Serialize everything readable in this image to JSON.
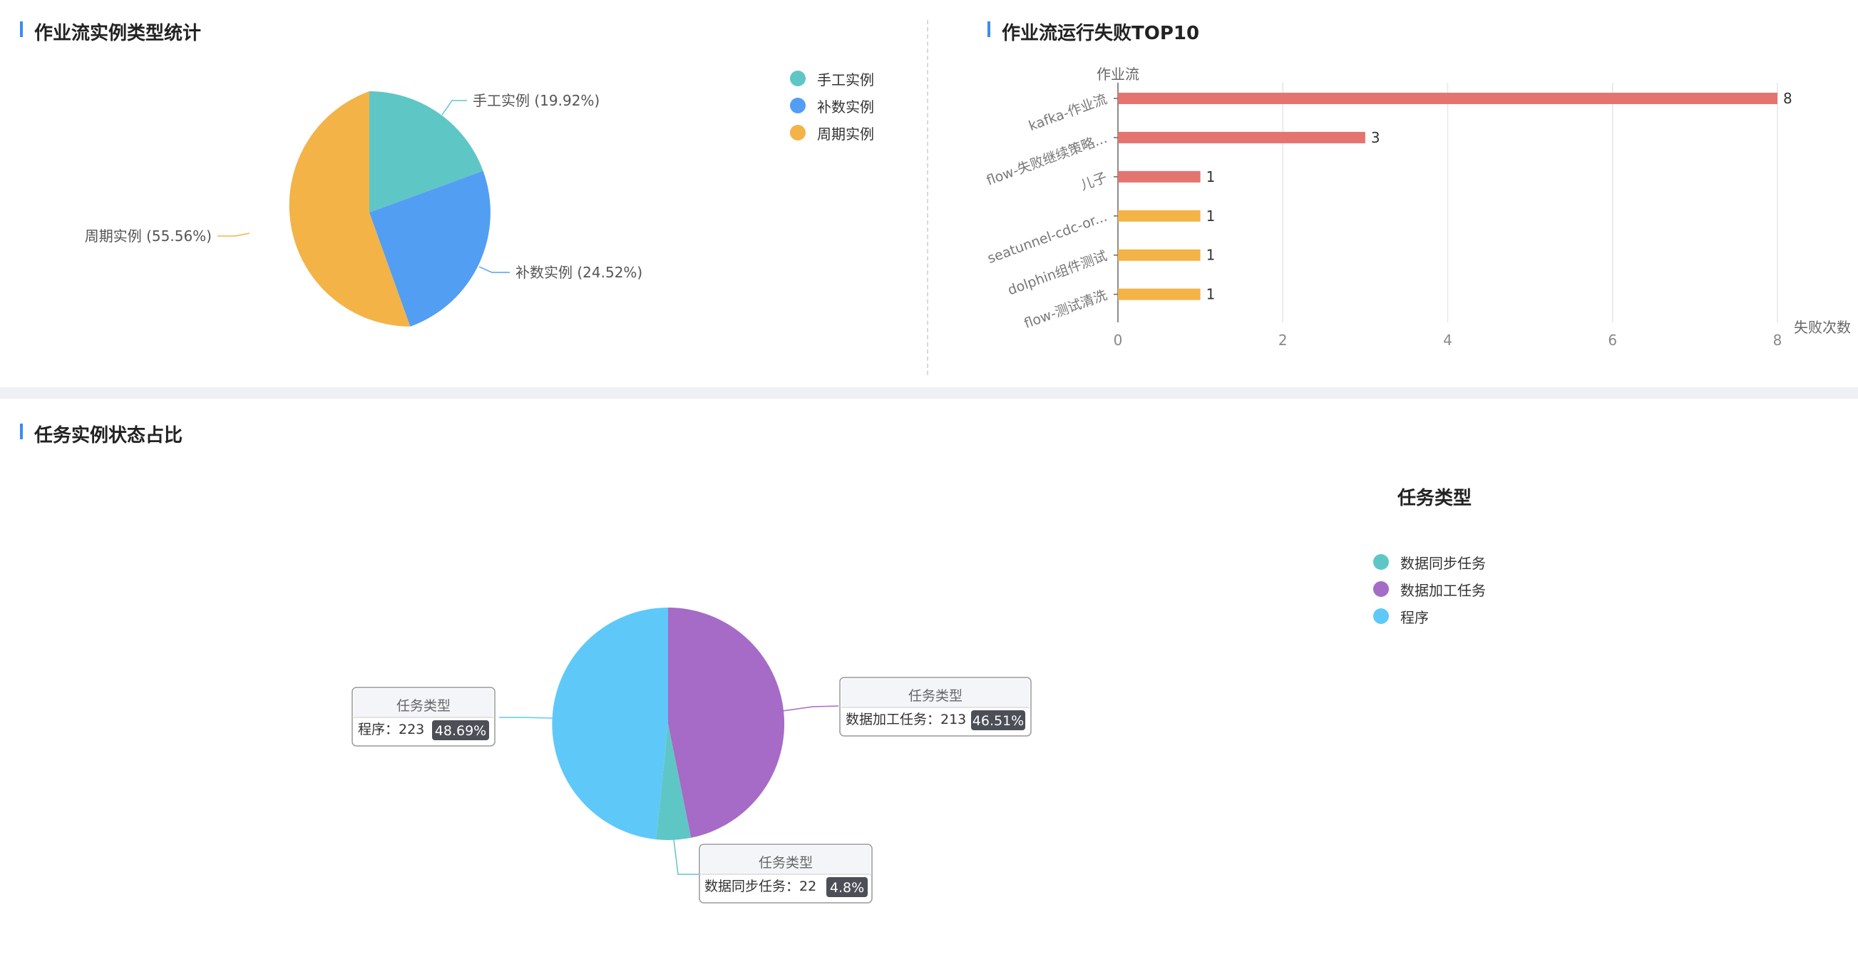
{
  "colors": {
    "teal": "#5fc6c6",
    "blue": "#529ef3",
    "orange": "#f3b347",
    "red": "#e47470",
    "purple": "#a56bc6",
    "sky": "#5ec9f8",
    "accent": "#3b8cf0"
  },
  "panels": {
    "top_left_title": "作业流实例类型统计",
    "top_right_title": "作业流运行失败TOP10",
    "bottom_title": "任务实例状态占比"
  },
  "chart_data": [
    {
      "type": "pie",
      "title": "作业流实例类型统计",
      "legend_position": "top-right",
      "slices": [
        {
          "name": "手工实例",
          "percent": 19.92,
          "label": "手工实例 (19.92%)",
          "color": "#5fc6c6"
        },
        {
          "name": "补数实例",
          "percent": 24.52,
          "label": "补数实例 (24.52%)",
          "color": "#529ef3"
        },
        {
          "name": "周期实例",
          "percent": 55.56,
          "label": "周期实例 (55.56%)",
          "color": "#f3b347"
        }
      ]
    },
    {
      "type": "bar",
      "orientation": "horizontal",
      "title": "作业流运行失败TOP10",
      "ylabel": "作业流",
      "xlabel": "失败次数",
      "xlim": [
        0,
        8
      ],
      "xticks": [
        "0",
        "2",
        "4",
        "6",
        "8"
      ],
      "grid": true,
      "categories": [
        "kafka-作业流",
        "flow-失败继续策略...",
        "儿子",
        "seatunnel-cdc-or...",
        "dolphin组件测试",
        "flow-测试清洗"
      ],
      "values": [
        8,
        3,
        1,
        1,
        1,
        1
      ],
      "colors": [
        "#e47470",
        "#e47470",
        "#e47470",
        "#f3b347",
        "#f3b347",
        "#f3b347"
      ]
    },
    {
      "type": "pie",
      "title": "任务实例状态占比",
      "legend_title": "任务类型",
      "legend_position": "right",
      "slices": [
        {
          "name": "数据同步任务",
          "value": 22,
          "percent": "4.8%",
          "color": "#5fc6c6",
          "tooltip_title": "任务类型",
          "tooltip_text": "数据同步任务：22"
        },
        {
          "name": "数据加工任务",
          "value": 213,
          "percent": "46.51%",
          "color": "#a56bc6",
          "tooltip_title": "任务类型",
          "tooltip_text": "数据加工任务：213"
        },
        {
          "name": "程序",
          "value": 223,
          "percent": "48.69%",
          "color": "#5ec9f8",
          "tooltip_title": "任务类型",
          "tooltip_text": "程序：223"
        }
      ]
    }
  ]
}
